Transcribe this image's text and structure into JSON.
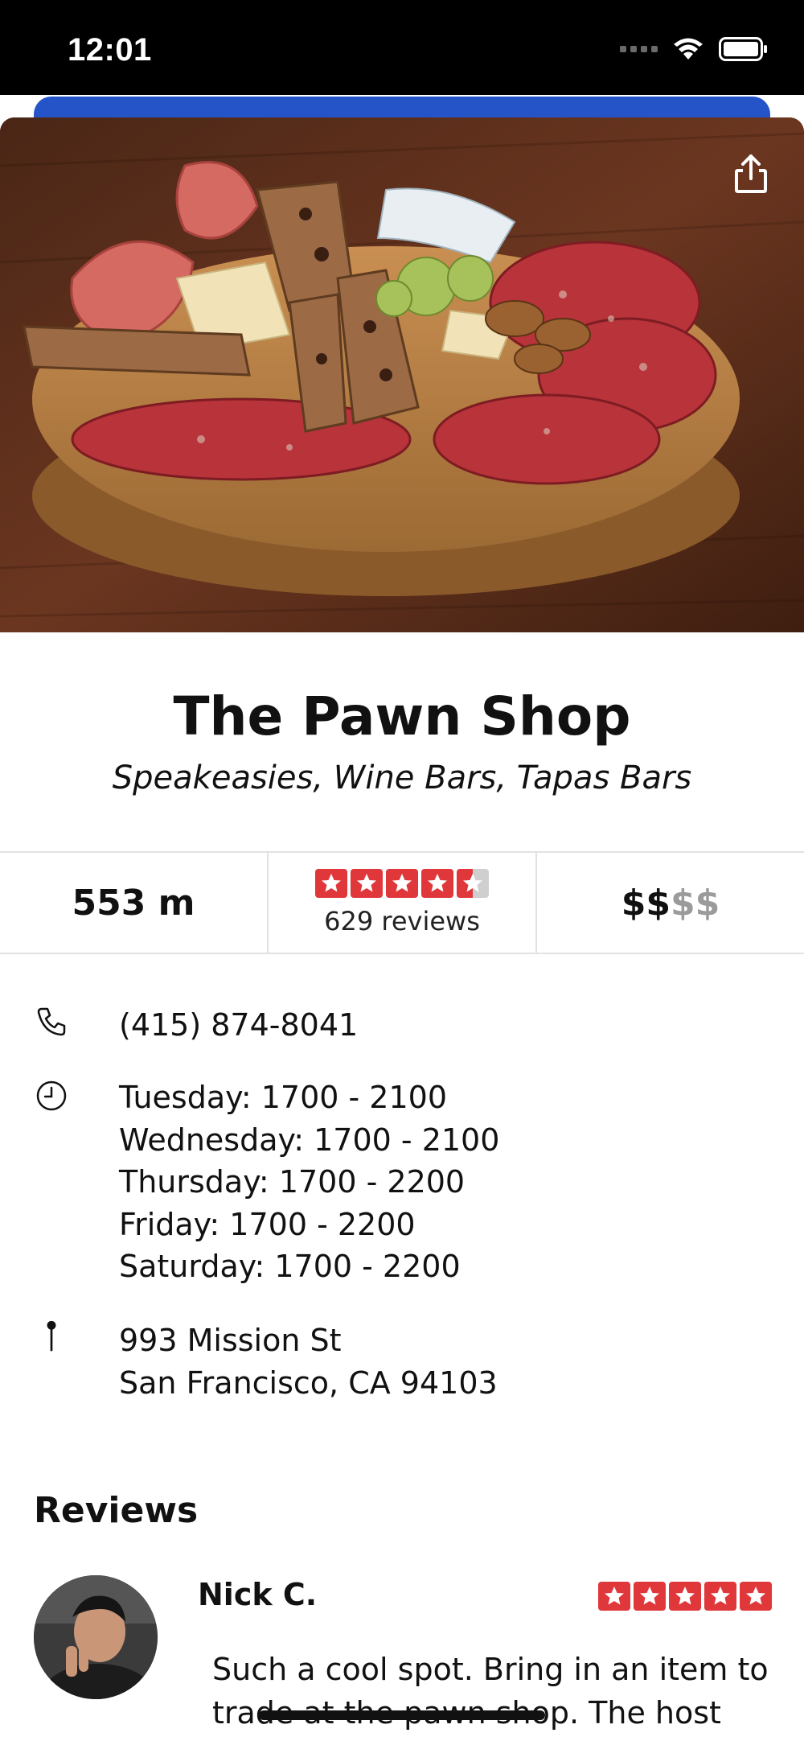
{
  "status_bar": {
    "time": "12:01"
  },
  "business": {
    "name": "The Pawn Shop",
    "categories": "Speakeasies, Wine Bars, Tapas Bars"
  },
  "stats": {
    "distance": "553 m",
    "rating": 4.5,
    "review_count": "629 reviews",
    "price_active": "$$",
    "price_inactive": "$$"
  },
  "contact": {
    "phone": "(415) 874-8041",
    "hours": [
      "Tuesday: 1700 - 2100",
      "Wednesday: 1700 - 2100",
      "Thursday: 1700 - 2200",
      "Friday: 1700 - 2200",
      "Saturday: 1700 - 2200"
    ],
    "address_line1": "993 Mission St",
    "address_line2": "San Francisco, CA 94103"
  },
  "reviews": {
    "heading": "Reviews",
    "items": [
      {
        "author": "Nick C.",
        "rating": 5,
        "text": "Such a cool spot. Bring in an item to trade at the pawn shop. The host will"
      }
    ]
  },
  "colors": {
    "accent_blue": "#2454c8",
    "star_red": "#e0373a",
    "star_empty": "#cfcfcf",
    "divider": "#e2e2e2"
  },
  "icons": [
    "wifi-icon",
    "battery-icon",
    "share-icon",
    "phone-icon",
    "clock-icon",
    "location-pin-icon",
    "star-icon"
  ]
}
